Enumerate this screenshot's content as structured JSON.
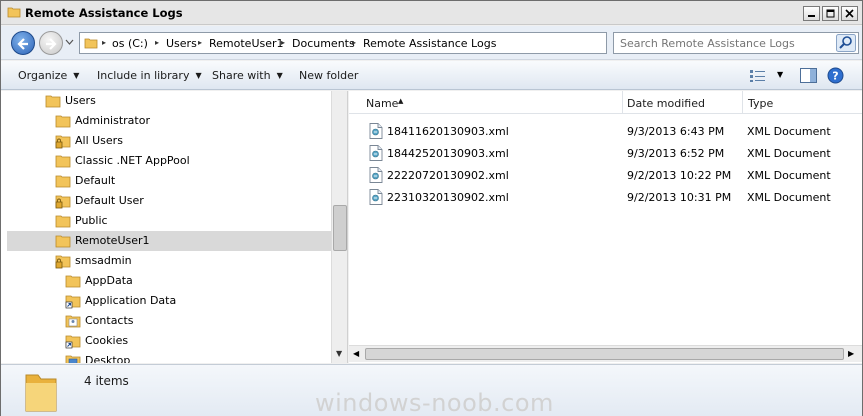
{
  "window": {
    "title": "Remote Assistance Logs"
  },
  "address": {
    "breadcrumbs": [
      "os (C:)",
      "Users",
      "RemoteUser1",
      "Documents",
      "Remote Assistance Logs"
    ]
  },
  "search": {
    "placeholder": "Search Remote Assistance Logs"
  },
  "toolbar": {
    "organize": "Organize",
    "include_in_library": "Include in library",
    "share_with": "Share with",
    "new_folder": "New folder"
  },
  "nav_tree": {
    "items": [
      {
        "label": "Users",
        "icon": "folder-icon"
      },
      {
        "label": "Administrator",
        "icon": "folder-icon"
      },
      {
        "label": "All Users",
        "icon": "locked-folder-icon"
      },
      {
        "label": "Classic .NET AppPool",
        "icon": "folder-icon"
      },
      {
        "label": "Default",
        "icon": "folder-icon"
      },
      {
        "label": "Default User",
        "icon": "locked-folder-icon"
      },
      {
        "label": "Public",
        "icon": "folder-icon"
      },
      {
        "label": "RemoteUser1",
        "icon": "folder-icon",
        "selected": true
      },
      {
        "label": "smsadmin",
        "icon": "locked-folder-icon"
      },
      {
        "label": "AppData",
        "icon": "folder-icon"
      },
      {
        "label": "Application Data",
        "icon": "shortcut-folder-icon"
      },
      {
        "label": "Contacts",
        "icon": "contacts-folder-icon"
      },
      {
        "label": "Cookies",
        "icon": "shortcut-folder-icon"
      },
      {
        "label": "Desktop",
        "icon": "desktop-folder-icon"
      }
    ]
  },
  "file_list": {
    "columns": [
      "Name",
      "Date modified",
      "Type"
    ],
    "rows": [
      {
        "name": "18411620130903.xml",
        "date": "9/3/2013 6:43 PM",
        "type": "XML Document"
      },
      {
        "name": "18442520130903.xml",
        "date": "9/3/2013 6:52 PM",
        "type": "XML Document"
      },
      {
        "name": "22220720130902.xml",
        "date": "9/2/2013 10:22 PM",
        "type": "XML Document"
      },
      {
        "name": "22310320130902.xml",
        "date": "9/2/2013 10:31 PM",
        "type": "XML Document"
      }
    ]
  },
  "details": {
    "item_count": "4 items"
  },
  "watermark": "windows-noob.com",
  "colors": {
    "accent": "#2d64b8",
    "selection": "#d9d9d9",
    "folder": "#f2c45a"
  }
}
